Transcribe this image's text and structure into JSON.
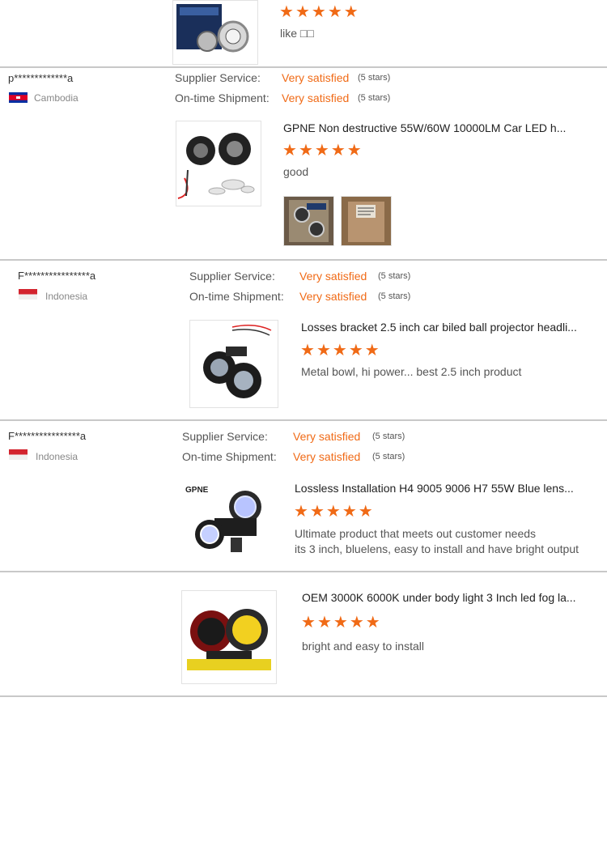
{
  "reviews": [
    {
      "product": {
        "stars_value": 5,
        "comment": "like □□"
      }
    },
    {
      "user": "p*************a",
      "country": "Cambodia",
      "supplier_label": "Supplier Service:",
      "supplier_value": "Very satisfied",
      "supplier_stars": "(5 stars)",
      "shipment_label": "On-time Shipment:",
      "shipment_value": "Very satisfied",
      "shipment_stars": "(5 stars)",
      "product": {
        "title": "GPNE Non destructive 55W/60W 10000LM Car LED h...",
        "stars_value": 5,
        "comment": "good"
      }
    },
    {
      "user": "F****************a",
      "country": "Indonesia",
      "supplier_label": "Supplier Service:",
      "supplier_value": "Very satisfied",
      "supplier_stars": "(5 stars)",
      "shipment_label": "On-time Shipment:",
      "shipment_value": "Very satisfied",
      "shipment_stars": "(5 stars)",
      "product": {
        "title": "Losses bracket 2.5 inch car biled ball projector headli...",
        "stars_value": 5,
        "comment": "Metal bowl, hi power... best 2.5 inch product"
      }
    },
    {
      "user": "F****************a",
      "country": "Indonesia",
      "supplier_label": "Supplier Service:",
      "supplier_value": "Very satisfied",
      "supplier_stars": "(5 stars)",
      "shipment_label": "On-time Shipment:",
      "shipment_value": "Very satisfied",
      "shipment_stars": "(5 stars)",
      "product": {
        "title": "Lossless Installation H4 9005 9006 H7 55W Blue lens...",
        "stars_value": 5,
        "comment_line1": "Ultimate product that meets out customer needs",
        "comment_line2": "its 3 inch, bluelens, easy to install and have bright output",
        "image_brand": "GPNE"
      }
    },
    {
      "product": {
        "title": "OEM 3000K 6000K under body light 3 Inch led fog la...",
        "stars_value": 5,
        "comment": "bright and easy to install"
      }
    }
  ],
  "colors": {
    "accent": "#f06a16",
    "divider": "#c8c8c8"
  }
}
